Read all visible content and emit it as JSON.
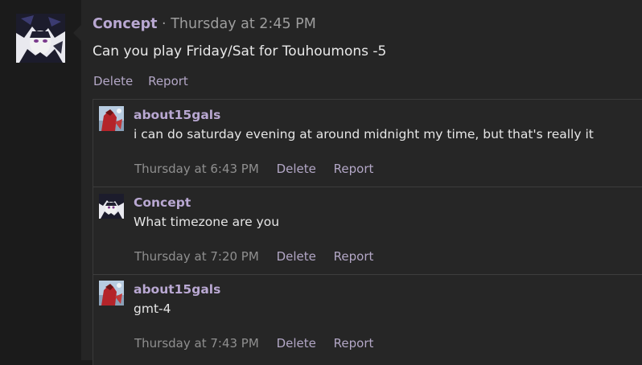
{
  "post": {
    "author": "Concept",
    "separator": "·",
    "time": "Thursday at 2:45 PM",
    "body": "Can you play Friday/Sat for Touhoumons -5",
    "actions": {
      "delete": "Delete",
      "report": "Report"
    }
  },
  "replies": [
    {
      "author": "about15gals",
      "text": "i can do saturday evening at around midnight my time, but that's really it",
      "time": "Thursday at 6:43 PM",
      "delete": "Delete",
      "report": "Report",
      "avatar": "red-figure-avatar"
    },
    {
      "author": "Concept",
      "text": "What timezone are you",
      "time": "Thursday at 7:20 PM",
      "delete": "Delete",
      "report": "Report",
      "avatar": "dark-anime-avatar"
    },
    {
      "author": "about15gals",
      "text": "gmt-4",
      "time": "Thursday at 7:43 PM",
      "delete": "Delete",
      "report": "Report",
      "avatar": "red-figure-avatar"
    }
  ],
  "colors": {
    "author": "#b9a8d2",
    "action": "#b3a7c6",
    "panel": "#252525",
    "background": "#1b1b1b"
  }
}
